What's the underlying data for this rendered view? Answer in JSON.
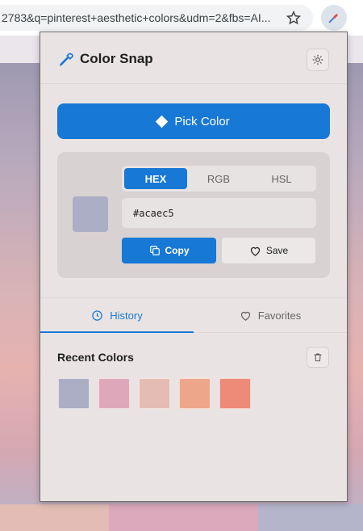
{
  "browser": {
    "url": "2783&q=pinterest+aesthetic+colors&udm=2&fbs=AI...",
    "icons": [
      "star-icon",
      "eyedropper-extension-icon"
    ]
  },
  "popup": {
    "title": "Color Snap",
    "pick_button": "Pick Color",
    "formats": [
      "HEX",
      "RGB",
      "HSL"
    ],
    "active_format": "HEX",
    "current_color": {
      "hex": "#acaec5",
      "display_value": "#acaec5"
    },
    "copy_button": "Copy",
    "save_button": "Save",
    "tabs": [
      {
        "label": "History",
        "icon": "clock-icon",
        "active": true
      },
      {
        "label": "Favorites",
        "icon": "heart-icon",
        "active": false
      }
    ],
    "recent_title": "Recent Colors",
    "recent_colors": [
      "#acaec5",
      "#dfa8ba",
      "#e5bcb3",
      "#eea68a",
      "#ee8a78"
    ]
  },
  "bottom_strip_colors": [
    "#e2bcb5",
    "#dca8bb",
    "#b4b4cb"
  ],
  "colors": {
    "accent": "#1778d6",
    "popup_bg": "#e9e4e3",
    "card_bg": "#d8d2d2"
  }
}
